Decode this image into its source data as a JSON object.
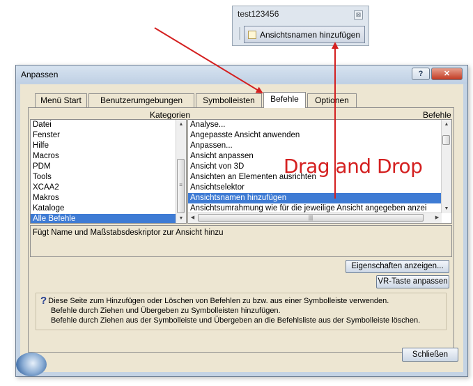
{
  "toolbar": {
    "title": "test123456",
    "close_glyph": "⊠",
    "button_label": "Ansichtsnamen hinzufügen"
  },
  "dialog": {
    "title": "Anpassen",
    "help_glyph": "?",
    "close_glyph": "✕",
    "tabs": [
      {
        "label": "Menü Start",
        "active": false
      },
      {
        "label": "Benutzerumgebungen",
        "active": false
      },
      {
        "label": "Symbolleisten",
        "active": false
      },
      {
        "label": "Befehle",
        "active": true
      },
      {
        "label": "Optionen",
        "active": false
      }
    ],
    "categories_header": "Kategorien",
    "commands_header": "Befehle",
    "categories": [
      "Datei",
      "Fenster",
      "Hilfe",
      "Macros",
      "PDM",
      "Tools",
      "XCAA2",
      "Makros",
      "Kataloge",
      "Alle Befehle"
    ],
    "selected_category": "Alle Befehle",
    "commands": [
      "Analyse...",
      "Angepasste Ansicht anwenden",
      "Anpassen...",
      "Ansicht anpassen",
      "Ansicht von 3D",
      "Ansichten an Elementen ausrichten",
      "Ansichtselektor",
      "Ansichtsnamen hinzufügen",
      "Ansichtsumrahmung wie für die jeweilige Ansicht angegeben anzei"
    ],
    "selected_command": "Ansichtsnamen hinzufügen",
    "description": "Fügt Name und Maßstabsdeskriptor zur Ansicht hinzu",
    "properties_button": "Eigenschaften anzeigen...",
    "vr_button": "VR-Taste anpassen",
    "info_lines": [
      "Diese Seite zum Hinzufügen oder Löschen von Befehlen zu bzw. aus einer Symbolleiste verwenden.",
      "Befehle durch Ziehen und Übergeben zu Symbolleisten hinzufügen.",
      "Befehle durch Ziehen aus der Symbolleiste und Übergeben an die Befehlsliste aus der Symbolleiste löschen."
    ],
    "close_button": "Schließen"
  },
  "annotation": {
    "text": "Drag and Drop",
    "color": "#d42020"
  },
  "colors": {
    "selection": "#3e7bd4",
    "dialog_bg": "#ede6d2",
    "frame": "#c4d3e4"
  },
  "icons": {
    "toolbar_command": "view-name-icon",
    "info": "question-mark-icon"
  }
}
